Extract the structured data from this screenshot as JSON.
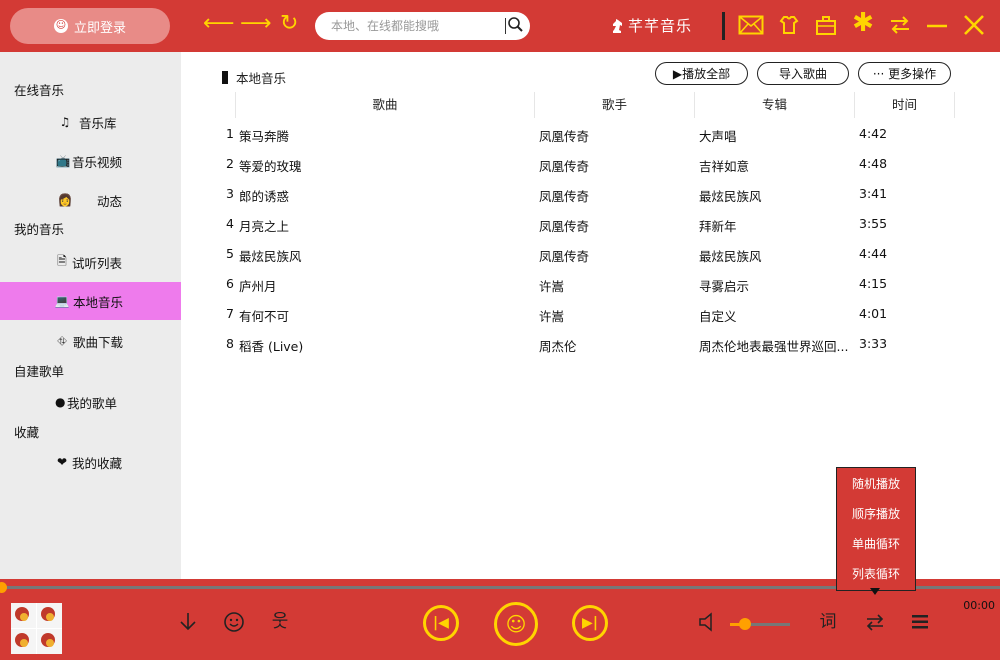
{
  "header": {
    "login_label": "立即登录",
    "search_placeholder": "本地、在线都能搜哦",
    "brand": "芊芊音乐"
  },
  "sidebar": {
    "sections": {
      "online": "在线音乐",
      "mine": "我的音乐",
      "custom": "自建歌单",
      "fav": "收藏"
    },
    "items": {
      "library": "音乐库",
      "video": "音乐视频",
      "feed": "动态",
      "trial": "试听列表",
      "local": "本地音乐",
      "download": "歌曲下载",
      "myplaylist": "我的歌单",
      "myfav": "我的收藏"
    }
  },
  "main": {
    "title": "本地音乐",
    "buttons": {
      "play_all": "▶播放全部",
      "import": "导入歌曲",
      "more": "··· 更多操作"
    },
    "columns": [
      "歌曲",
      "歌手",
      "专辑",
      "时间"
    ],
    "rows": [
      {
        "num": "1",
        "title": "策马奔腾",
        "artist": "凤凰传奇",
        "album": "大声唱",
        "time": "4:42"
      },
      {
        "num": "2",
        "title": "等爱的玫瑰",
        "artist": "凤凰传奇",
        "album": "吉祥如意",
        "time": "4:48"
      },
      {
        "num": "3",
        "title": "郎的诱惑",
        "artist": "凤凰传奇",
        "album": "最炫民族风",
        "time": "3:41"
      },
      {
        "num": "4",
        "title": "月亮之上",
        "artist": "凤凰传奇",
        "album": "拜新年",
        "time": "3:55"
      },
      {
        "num": "5",
        "title": "最炫民族风",
        "artist": "凤凰传奇",
        "album": "最炫民族风",
        "time": "4:44"
      },
      {
        "num": "6",
        "title": "庐州月",
        "artist": "许嵩",
        "album": "寻雾启示",
        "time": "4:15"
      },
      {
        "num": "7",
        "title": "有何不可",
        "artist": "许嵩",
        "album": "自定义",
        "time": "4:01"
      },
      {
        "num": "8",
        "title": "稻香 (Live)",
        "artist": "周杰伦",
        "album": "周杰伦地表最强世界巡回...",
        "time": "3:33"
      }
    ]
  },
  "play_mode_menu": [
    "随机播放",
    "顺序播放",
    "单曲循环",
    "列表循环"
  ],
  "player": {
    "elapsed": "00:00",
    "lyrics_label": "词",
    "progress": 0,
    "volume": 0.25
  },
  "colors": {
    "primary": "#d33a35",
    "accent": "#ffd400",
    "active_item": "#ee7bec",
    "sidebar_bg": "#ececec",
    "progress": "#ffa000"
  }
}
